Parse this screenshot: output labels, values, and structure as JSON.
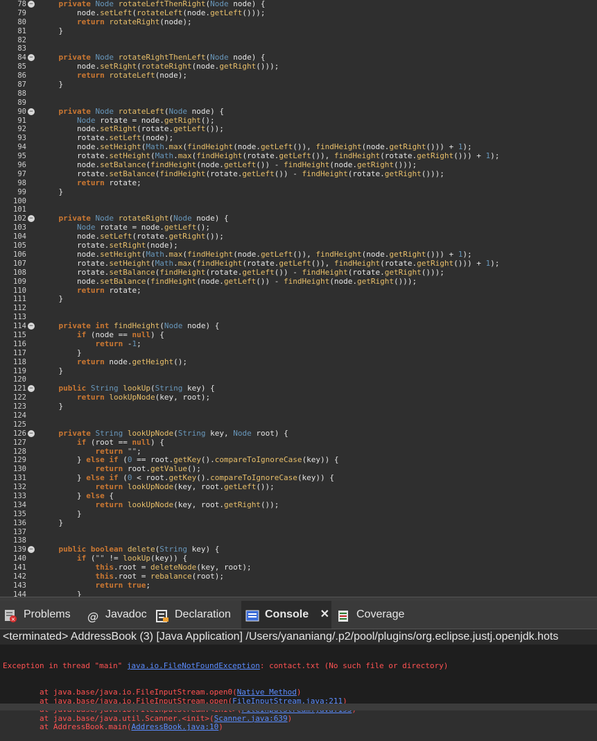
{
  "editor": {
    "lines": [
      {
        "n": "78",
        "fold": true,
        "t": "    private Node rotateLeftThenRight(Node node) {"
      },
      {
        "n": "79",
        "t": "        node.setLeft(rotateLeft(node.getLeft()));"
      },
      {
        "n": "80",
        "t": "        return rotateRight(node);"
      },
      {
        "n": "81",
        "t": "    }"
      },
      {
        "n": "82",
        "t": ""
      },
      {
        "n": "83",
        "t": ""
      },
      {
        "n": "84",
        "fold": true,
        "t": "    private Node rotateRightThenLeft(Node node) {"
      },
      {
        "n": "85",
        "t": "        node.setRight(rotateRight(node.getRight()));"
      },
      {
        "n": "86",
        "t": "        return rotateLeft(node);"
      },
      {
        "n": "87",
        "t": "    }"
      },
      {
        "n": "88",
        "t": ""
      },
      {
        "n": "89",
        "t": ""
      },
      {
        "n": "90",
        "fold": true,
        "t": "    private Node rotateLeft(Node node) {"
      },
      {
        "n": "91",
        "t": "        Node rotate = node.getRight();"
      },
      {
        "n": "92",
        "t": "        node.setRight(rotate.getLeft());"
      },
      {
        "n": "93",
        "t": "        rotate.setLeft(node);"
      },
      {
        "n": "94",
        "t": "        node.setHeight(Math.max(findHeight(node.getLeft()), findHeight(node.getRight())) + 1);"
      },
      {
        "n": "95",
        "t": "        rotate.setHeight(Math.max(findHeight(rotate.getLeft()), findHeight(rotate.getRight())) + 1);"
      },
      {
        "n": "96",
        "t": "        node.setBalance(findHeight(node.getLeft()) - findHeight(node.getRight()));"
      },
      {
        "n": "97",
        "t": "        rotate.setBalance(findHeight(rotate.getLeft()) - findHeight(rotate.getRight()));"
      },
      {
        "n": "98",
        "t": "        return rotate;"
      },
      {
        "n": "99",
        "t": "    }"
      },
      {
        "n": "100",
        "t": ""
      },
      {
        "n": "101",
        "t": ""
      },
      {
        "n": "102",
        "fold": true,
        "t": "    private Node rotateRight(Node node) {"
      },
      {
        "n": "103",
        "t": "        Node rotate = node.getLeft();"
      },
      {
        "n": "104",
        "t": "        node.setLeft(rotate.getRight());"
      },
      {
        "n": "105",
        "t": "        rotate.setRight(node);"
      },
      {
        "n": "106",
        "t": "        node.setHeight(Math.max(findHeight(node.getLeft()), findHeight(node.getRight())) + 1);"
      },
      {
        "n": "107",
        "t": "        rotate.setHeight(Math.max(findHeight(rotate.getLeft()), findHeight(rotate.getRight())) + 1);"
      },
      {
        "n": "108",
        "t": "        rotate.setBalance(findHeight(rotate.getLeft()) - findHeight(rotate.getRight()));"
      },
      {
        "n": "109",
        "t": "        node.setBalance(findHeight(node.getLeft()) - findHeight(node.getRight()));"
      },
      {
        "n": "110",
        "t": "        return rotate;"
      },
      {
        "n": "111",
        "t": "    }"
      },
      {
        "n": "112",
        "t": ""
      },
      {
        "n": "113",
        "t": ""
      },
      {
        "n": "114",
        "fold": true,
        "t": "    private int findHeight(Node node) {"
      },
      {
        "n": "115",
        "t": "        if (node == null) {"
      },
      {
        "n": "116",
        "t": "            return -1;"
      },
      {
        "n": "117",
        "t": "        }"
      },
      {
        "n": "118",
        "t": "        return node.getHeight();"
      },
      {
        "n": "119",
        "t": "    }"
      },
      {
        "n": "120",
        "t": ""
      },
      {
        "n": "121",
        "fold": true,
        "t": "    public String lookUp(String key) {"
      },
      {
        "n": "122",
        "t": "        return lookUpNode(key, root);"
      },
      {
        "n": "123",
        "t": "    }"
      },
      {
        "n": "124",
        "t": ""
      },
      {
        "n": "125",
        "t": ""
      },
      {
        "n": "126",
        "fold": true,
        "t": "    private String lookUpNode(String key, Node root) {"
      },
      {
        "n": "127",
        "t": "        if (root == null) {"
      },
      {
        "n": "128",
        "t": "            return \"\";"
      },
      {
        "n": "129",
        "t": "        } else if (0 == root.getKey().compareToIgnoreCase(key)) {"
      },
      {
        "n": "130",
        "t": "            return root.getValue();"
      },
      {
        "n": "131",
        "t": "        } else if (0 < root.getKey().compareToIgnoreCase(key)) {"
      },
      {
        "n": "132",
        "t": "            return lookUpNode(key, root.getLeft());"
      },
      {
        "n": "133",
        "t": "        } else {"
      },
      {
        "n": "134",
        "t": "            return lookUpNode(key, root.getRight());"
      },
      {
        "n": "135",
        "t": "        }"
      },
      {
        "n": "136",
        "t": "    }"
      },
      {
        "n": "137",
        "t": ""
      },
      {
        "n": "138",
        "t": ""
      },
      {
        "n": "139",
        "fold": true,
        "t": "    public boolean delete(String key) {"
      },
      {
        "n": "140",
        "t": "        if (\"\" != lookUp(key)) {"
      },
      {
        "n": "141",
        "t": "            this.root = deleteNode(key, root);"
      },
      {
        "n": "142",
        "t": "            this.root = rebalance(root);"
      },
      {
        "n": "143",
        "t": "            return true;"
      },
      {
        "n": "144",
        "t": "        }"
      }
    ]
  },
  "tabs": [
    {
      "label": "Problems",
      "icon": "problems-icon"
    },
    {
      "label": "Javadoc",
      "icon": "javadoc-icon"
    },
    {
      "label": "Declaration",
      "icon": "declaration-icon"
    },
    {
      "label": "Console",
      "icon": "console-icon",
      "active": true
    },
    {
      "label": "Coverage",
      "icon": "coverage-icon"
    }
  ],
  "console": {
    "header": "<terminated> AddressBook (3) [Java Application] /Users/yananiang/.p2/pool/plugins/org.eclipse.justj.openjdk.hots",
    "exception": {
      "prefix": "Exception in thread \"main\" ",
      "link": "java.io.FileNotFoundException",
      "suffix": ": contact.txt (No such file or directory)"
    },
    "trace": [
      {
        "prefix": "\tat java.base/java.io.FileInputStream.open0(",
        "link": "Native Method",
        "suffix": ")"
      },
      {
        "prefix": "\tat java.base/java.io.FileInputStream.open(",
        "link": "FileInputStream.java:211",
        "suffix": ")"
      },
      {
        "prefix": "\tat java.base/java.io.FileInputStream.<init>(",
        "link": "FileInputStream.java:153",
        "suffix": ")"
      },
      {
        "prefix": "\tat java.base/java.util.Scanner.<init>(",
        "link": "Scanner.java:639",
        "suffix": ")"
      },
      {
        "prefix": "\tat AddressBook.main(",
        "link": "AddressBook.java:10",
        "suffix": ")"
      }
    ]
  },
  "colors": {
    "background": "#2f2f2f",
    "error": "#ff5252",
    "link": "#5b8cff"
  }
}
